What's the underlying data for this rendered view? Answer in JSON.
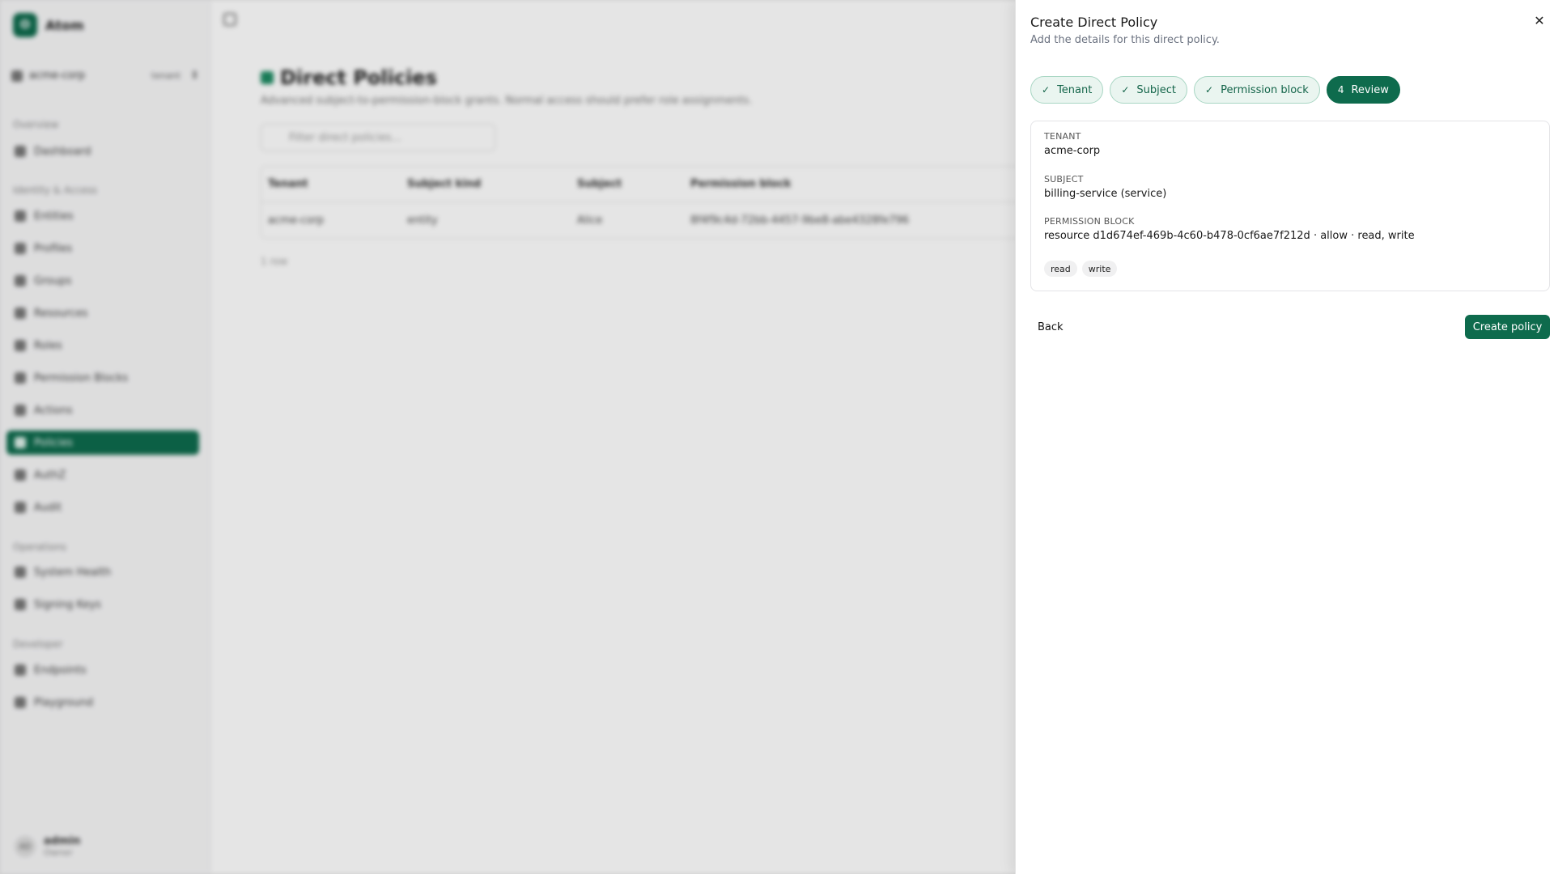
{
  "app": {
    "brand": "Atom",
    "brand_initial": "O",
    "tenant": {
      "name": "acme-corp",
      "badge": "tenant"
    },
    "sections": {
      "overview": "Overview",
      "identity": "Identity & Access",
      "operations": "Operations",
      "developer": "Developer"
    },
    "nav": {
      "dashboard": "Dashboard",
      "entities": "Entities",
      "profiles": "Profiles",
      "groups": "Groups",
      "resources": "Resources",
      "roles": "Roles",
      "permission_blocks": "Permission Blocks",
      "actions": "Actions",
      "policies": "Policies",
      "authz": "AuthZ",
      "audit": "Audit",
      "system_health": "System Health",
      "signing_keys": "Signing Keys",
      "endpoints": "Endpoints",
      "playground": "Playground"
    },
    "user": {
      "initials": "AD",
      "name": "admin",
      "role": "Owner"
    }
  },
  "page": {
    "title": "Direct Policies",
    "subtitle": "Advanced subject-to-permission-block grants. Normal access should prefer role assignments.",
    "filter_placeholder": "Filter direct policies...",
    "columns": [
      "Tenant",
      "Subject kind",
      "Subject",
      "Permission block"
    ],
    "rows": [
      [
        "acme-corp",
        "entity",
        "Alice",
        "8f4f9c4d-72bb-4457-9be8-abe4328fe796"
      ]
    ],
    "row_count": "1 row"
  },
  "drawer": {
    "title": "Create Direct Policy",
    "subtitle": "Add the details for this direct policy.",
    "steps": [
      {
        "label": "Tenant",
        "state": "done"
      },
      {
        "label": "Subject",
        "state": "done"
      },
      {
        "label": "Permission block",
        "state": "done"
      },
      {
        "number": "4",
        "label": "Review",
        "state": "current"
      }
    ],
    "review": {
      "tenant_label": "TENANT",
      "tenant_value": "acme-corp",
      "subject_label": "SUBJECT",
      "subject_value": "billing-service (service)",
      "block_label": "PERMISSION BLOCK",
      "block_value": "resource d1d674ef-469b-4c60-b478-0cf6ae7f212d · allow · read, write",
      "actions": [
        "read",
        "write"
      ]
    },
    "back_label": "Back",
    "create_label": "Create policy"
  },
  "colors": {
    "primary": "#0e6b4d",
    "step_done_bg": "#eaf5f0",
    "step_done_text": "#14654a"
  }
}
